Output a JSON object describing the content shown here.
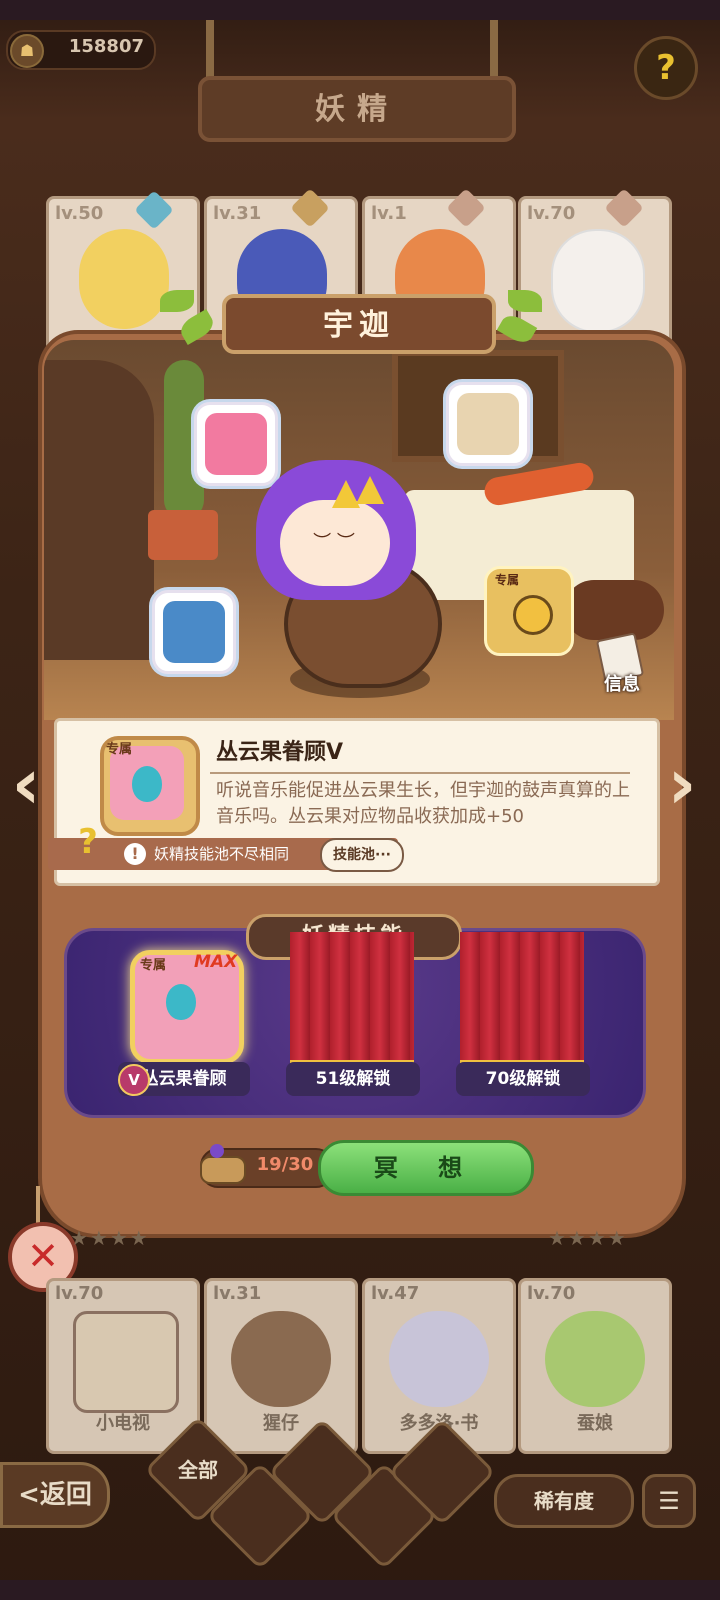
{
  "currency": {
    "amount": "158807"
  },
  "header": {
    "title": "妖精"
  },
  "top_cards": [
    {
      "level": "lv.50"
    },
    {
      "level": "lv.31"
    },
    {
      "level": "lv.1"
    },
    {
      "level": "lv.70"
    }
  ],
  "fairy": {
    "name": "宇迦"
  },
  "info_button": {
    "label": "信息"
  },
  "exclusive_tag": "专属",
  "skill_detail": {
    "tag": "专属",
    "name": "丛云果眷顾V",
    "description": "听说音乐能促进丛云果生长，但宇迦的鼓声真算的上音乐吗。丛云果对应物品收获加成+50",
    "warning": "妖精技能池不尽相同",
    "pool_button": "技能池···"
  },
  "skills_section": {
    "title": "妖精技能",
    "slots": [
      {
        "label": "丛云果眷顾",
        "tag": "专属",
        "badge": "MAX",
        "level_badge": "V"
      },
      {
        "label": "51级解锁"
      },
      {
        "label": "70级解锁"
      }
    ]
  },
  "meditation": {
    "count": "19/30",
    "button": "冥 想"
  },
  "bottom_cards": [
    {
      "level": "lv.70",
      "name": "小电视"
    },
    {
      "level": "lv.31",
      "name": "猩仔"
    },
    {
      "level": "lv.47",
      "name": "多多洛·书"
    },
    {
      "level": "lv.70",
      "name": "蚕娘"
    }
  ],
  "bottom_nav": {
    "back": "<返回",
    "filter_all": "全部",
    "rarity": "稀有度"
  },
  "colors": {
    "accent_green": "#4ab046",
    "panel_brown": "#a86c46",
    "skill_purple": "#3a2470",
    "curtain_red": "#b0202c"
  }
}
